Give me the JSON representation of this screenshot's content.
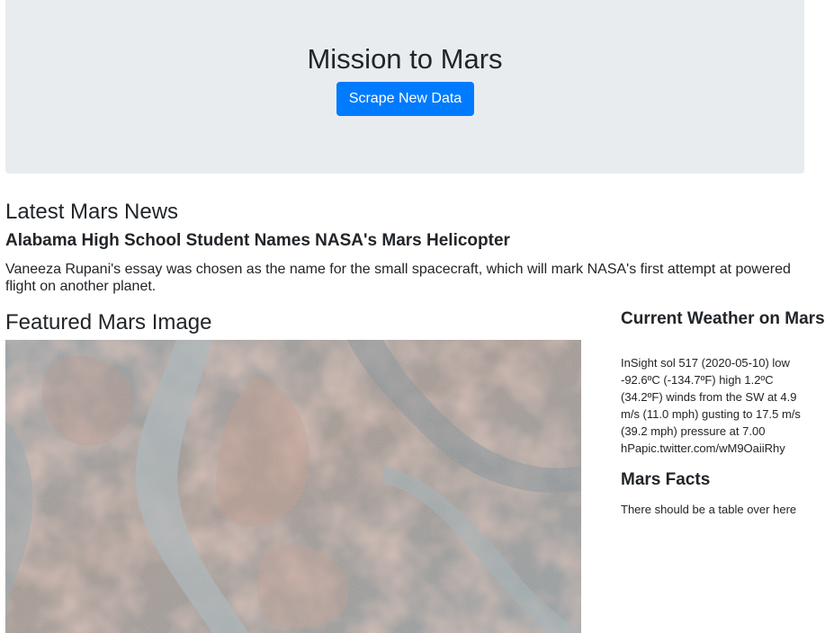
{
  "jumbotron": {
    "title": "Mission to Mars",
    "button_label": "Scrape New Data",
    "button_color": "#007bff",
    "background_color": "#e9ecef"
  },
  "news": {
    "section_title": "Latest Mars News",
    "headline": "Alabama High School Student Names NASA's Mars Helicopter",
    "paragraph": "Vaneeza Rupani's essay was chosen as the name for the small spacecraft, which will mark NASA's first attempt at powered flight on another planet."
  },
  "featured_image": {
    "section_title": "Featured Mars Image"
  },
  "weather": {
    "section_title": "Current Weather on Mars",
    "text": "InSight sol 517 (2020-05-10) low -92.6ºC (-134.7ºF) high 1.2ºC (34.2ºF) winds from the SW at 4.9 m/s (11.0 mph) gusting to 17.5 m/s (39.2 mph) pressure at 7.00 hPapic.twitter.com/wM9OaiiRhy"
  },
  "facts": {
    "section_title": "Mars Facts",
    "text": "There should be a table over here"
  }
}
